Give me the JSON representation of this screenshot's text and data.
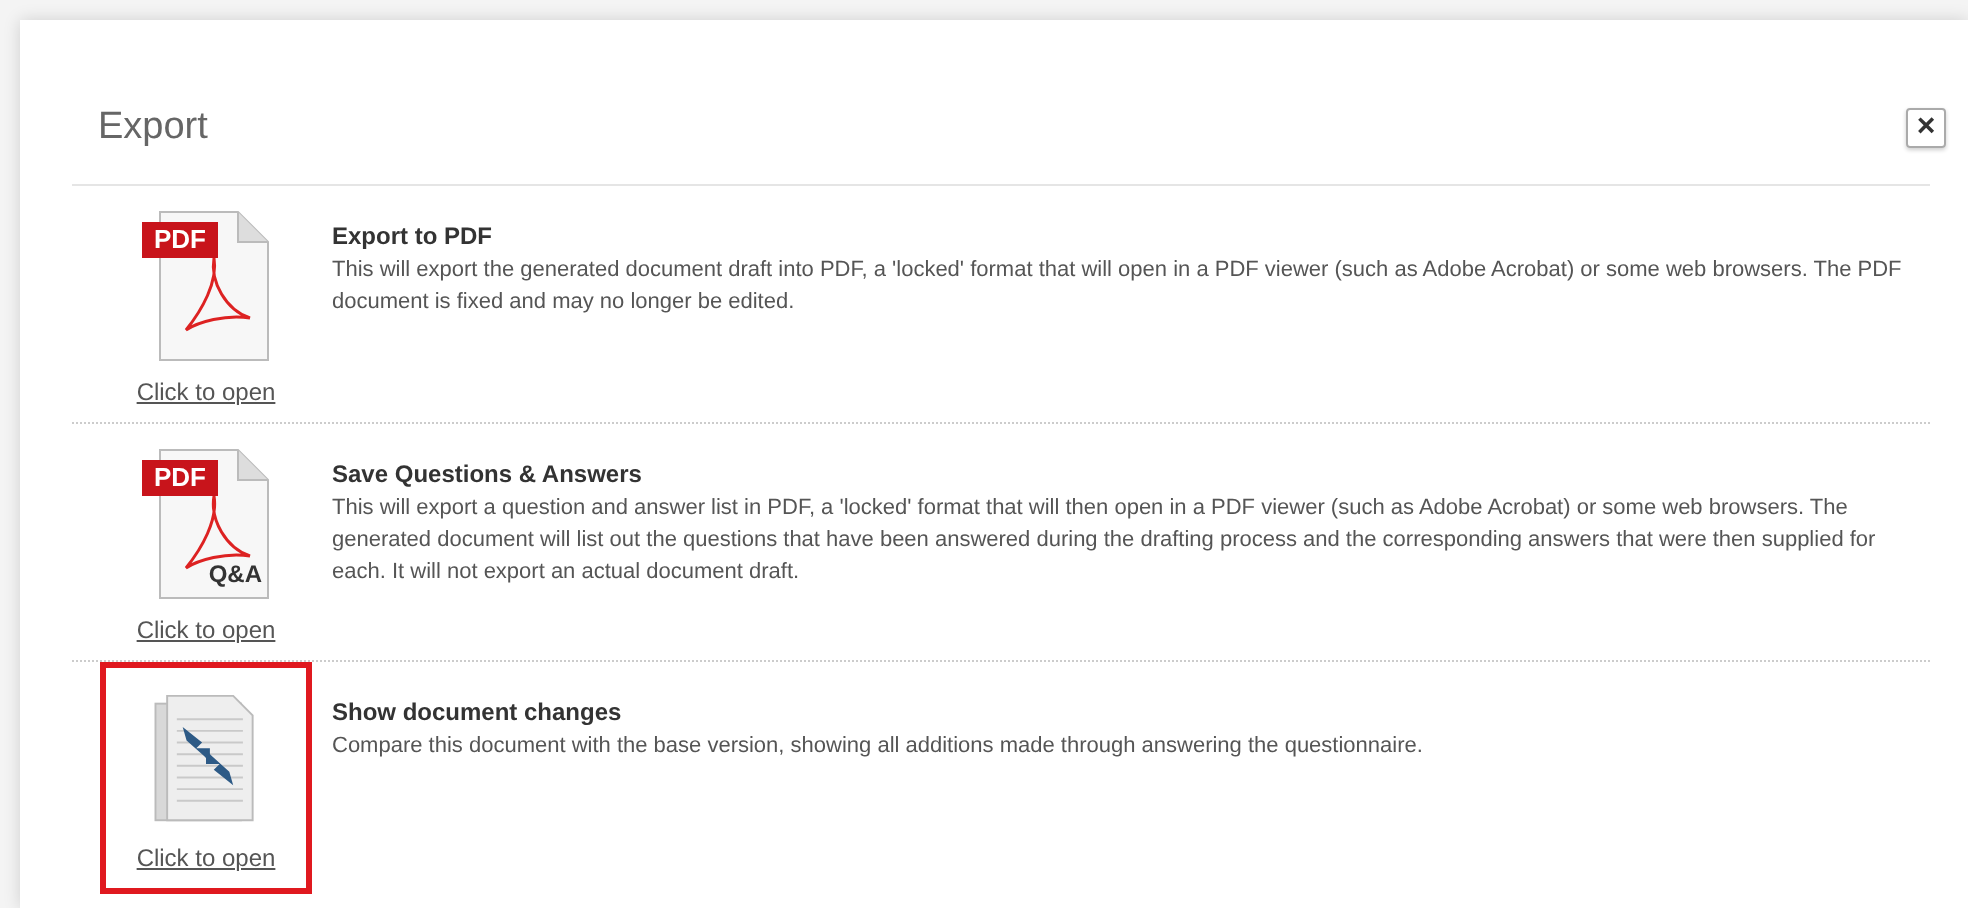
{
  "dialog": {
    "title": "Export",
    "close": "×"
  },
  "options": [
    {
      "kind": "pdf",
      "badge": "PDF",
      "link": "Click to open",
      "title": "Export to PDF",
      "description": "This will export the generated document draft into PDF, a 'locked' format that will open in a PDF viewer (such as Adobe Acrobat) or some web browsers. The PDF document is fixed and may no longer be edited.",
      "highlighted": false
    },
    {
      "kind": "qa",
      "badge": "PDF",
      "sub": "Q&A",
      "link": "Click to open",
      "title": "Save Questions & Answers",
      "description": "This will export a question and answer list in PDF, a 'locked' format that will then open in a PDF viewer (such as Adobe Acrobat) or some web browsers. The generated document will list out the questions that have been answered during the drafting process and the corresponding answers that were then supplied for each. It will not export an actual document draft.",
      "highlighted": false
    },
    {
      "kind": "compare",
      "link": "Click to open",
      "title": "Show document changes",
      "description": "Compare this document with the base version, showing all additions made through answering the questionnaire.",
      "highlighted": true
    }
  ]
}
